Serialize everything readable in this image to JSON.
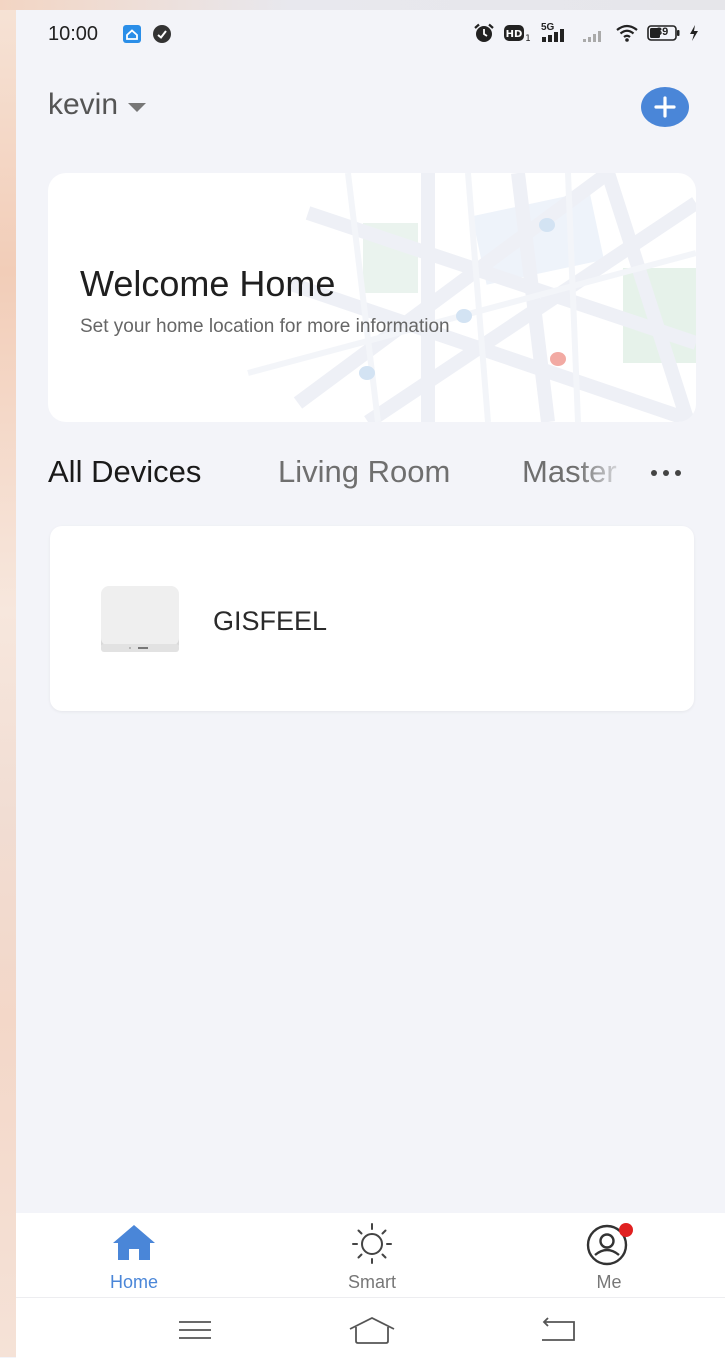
{
  "status_bar": {
    "time": "10:00",
    "network": "5G",
    "battery": "39",
    "icons": [
      "app-notification-icon",
      "vpn-icon",
      "alarm-icon",
      "hd-icon",
      "signal-5g-icon",
      "signal-icon",
      "wifi-icon",
      "battery-icon",
      "charging-icon"
    ]
  },
  "header": {
    "home_name": "kevin",
    "add_icon": "plus-icon"
  },
  "welcome": {
    "title": "Welcome Home",
    "subtitle": "Set your home location for more information"
  },
  "tabs": [
    {
      "label": "All Devices",
      "active": true
    },
    {
      "label": "Living Room",
      "active": false
    },
    {
      "label": "Master",
      "active": false
    }
  ],
  "devices": [
    {
      "name": "GISFEEL",
      "icon": "hub-device-icon"
    }
  ],
  "bottom_nav": [
    {
      "label": "Home",
      "icon": "home-icon",
      "active": true
    },
    {
      "label": "Smart",
      "icon": "sun-icon",
      "active": false
    },
    {
      "label": "Me",
      "icon": "user-icon",
      "active": false,
      "badge": true
    }
  ],
  "colors": {
    "accent": "#4a86d8",
    "background": "#f3f4f9",
    "badge": "#e02020"
  },
  "system_nav": [
    "menu-icon",
    "home-outline-icon",
    "back-icon"
  ]
}
